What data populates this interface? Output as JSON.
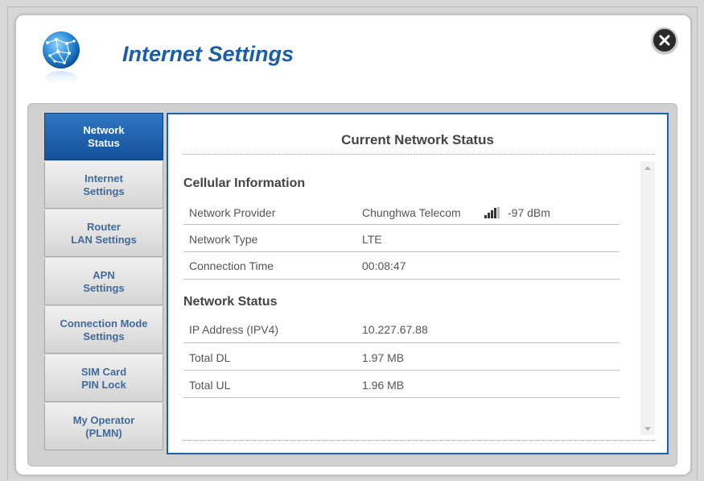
{
  "header": {
    "title": "Internet Settings"
  },
  "sidebar": {
    "items": [
      {
        "label": "Network\nStatus",
        "active": true
      },
      {
        "label": "Internet\nSettings",
        "active": false
      },
      {
        "label": "Router\nLAN Settings",
        "active": false
      },
      {
        "label": "APN\nSettings",
        "active": false
      },
      {
        "label": "Connection Mode\nSettings",
        "active": false
      },
      {
        "label": "SIM Card\nPIN Lock",
        "active": false
      },
      {
        "label": "My Operator\n(PLMN)",
        "active": false
      }
    ]
  },
  "main": {
    "title": "Current Network Status",
    "cellular": {
      "heading": "Cellular Information",
      "rows": [
        {
          "label": "Network Provider",
          "value": "Chunghwa Telecom"
        },
        {
          "label": "Network Type",
          "value": "LTE"
        },
        {
          "label": "Connection Time",
          "value": "00:08:47"
        }
      ],
      "signal": "-97 dBm"
    },
    "network": {
      "heading": "Network Status",
      "rows": [
        {
          "label": "IP Address (IPV4)",
          "value": "10.227.67.88"
        },
        {
          "label": "Total DL",
          "value": "1.97 MB"
        },
        {
          "label": "Total UL",
          "value": "1.96 MB"
        }
      ]
    }
  },
  "icons": {
    "globe": "globe-network-icon",
    "close": "close-icon",
    "signal": "signal-strength-icon"
  },
  "colors": {
    "accent": "#1b5ea8",
    "active_tab": "#1e63b0",
    "border": "#1b64b5"
  }
}
